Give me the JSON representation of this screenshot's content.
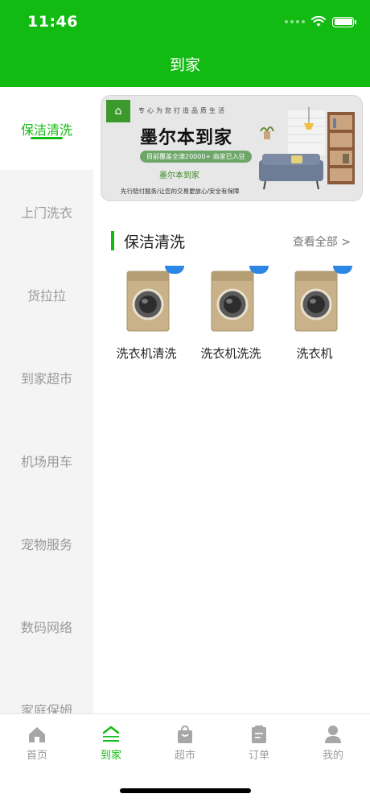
{
  "status": {
    "time": "11:46"
  },
  "nav": {
    "title": "到家"
  },
  "sidebar": {
    "items": [
      {
        "label": "保洁清洗",
        "active": true
      },
      {
        "label": "上门洗衣"
      },
      {
        "label": "货拉拉"
      },
      {
        "label": "到家超市"
      },
      {
        "label": "机场用车"
      },
      {
        "label": "宠物服务"
      },
      {
        "label": "数码网络"
      },
      {
        "label": "家庭保姆"
      }
    ]
  },
  "banner": {
    "logo_text": "⌂",
    "slogan": "专心为您打造品质生活",
    "title": "墨尔本到家",
    "pill": "目前覆盖全澳20000+ 商家已入驻",
    "brand": "墨尔本到家",
    "foot": "先行赔付服务/让您的交易更放心/安全有保障"
  },
  "section": {
    "title": "保洁清洗",
    "view_all": "查看全部 >"
  },
  "products": [
    {
      "name": "洗衣机清洗"
    },
    {
      "name": "洗衣机洗洗"
    },
    {
      "name": "洗衣机"
    }
  ],
  "tabbar": {
    "items": [
      {
        "label": "首页",
        "icon": "home-icon"
      },
      {
        "label": "到家",
        "icon": "daojia-icon",
        "active": true
      },
      {
        "label": "超市",
        "icon": "shopping-bag-icon"
      },
      {
        "label": "订单",
        "icon": "order-icon"
      },
      {
        "label": "我的",
        "icon": "profile-icon"
      }
    ]
  },
  "colors": {
    "brand_green": "#12bb12",
    "badge_blue": "#2b86e6"
  }
}
